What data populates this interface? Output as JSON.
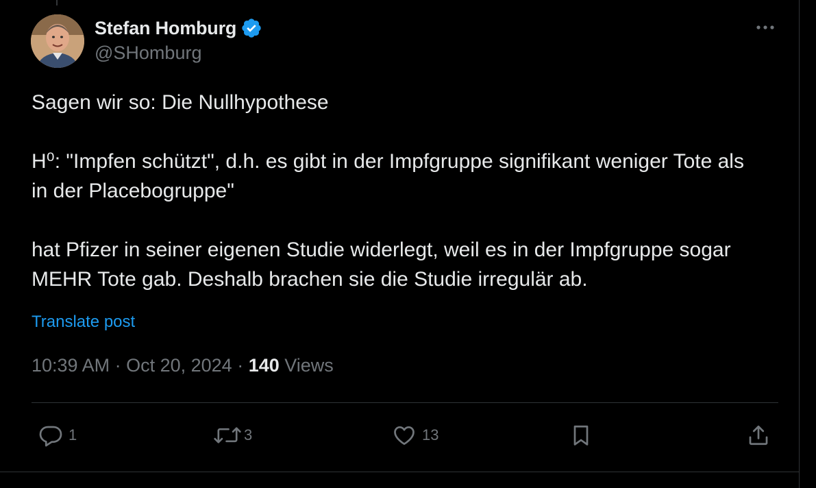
{
  "author": {
    "display_name": "Stefan Homburg",
    "handle": "@SHomburg",
    "verified": true
  },
  "tweet": {
    "paragraphs": [
      "Sagen wir so: Die Nullhypothese",
      "H⁰: \"Impfen schützt\", d.h. es gibt in der Impfgruppe signifikant weniger Tote als in der Placebogruppe\"",
      "hat Pfizer in seiner eigenen Studie widerlegt, weil es in der Impfgruppe sogar MEHR Tote gab. Deshalb brachen sie die Studie irregulär ab."
    ],
    "translate_label": "Translate post",
    "time": "10:39 AM",
    "date": "Oct 20, 2024",
    "separator": " · ",
    "views_count": "140",
    "views_label": "Views"
  },
  "actions": {
    "replies": "1",
    "reposts": "3",
    "likes": "13"
  },
  "icons": {
    "more": "more-horizontal-icon",
    "verified": "verified-badge-icon",
    "reply": "reply-icon",
    "repost": "repost-icon",
    "like": "heart-icon",
    "bookmark": "bookmark-icon",
    "share": "share-icon"
  },
  "colors": {
    "background": "#000000",
    "text": "#e7e9ea",
    "secondary": "#71767b",
    "accent": "#1d9bf0",
    "border": "#2f3336"
  }
}
